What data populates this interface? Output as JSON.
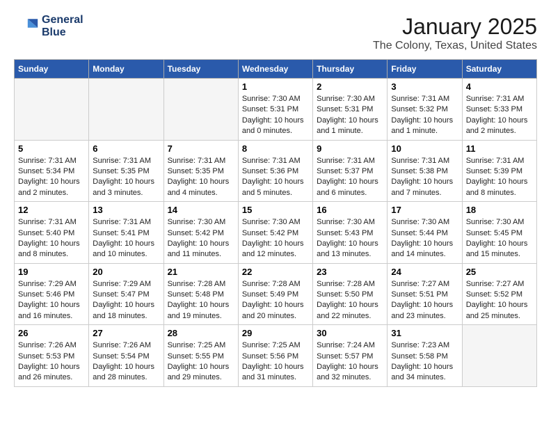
{
  "header": {
    "logo_line1": "General",
    "logo_line2": "Blue",
    "title": "January 2025",
    "subtitle": "The Colony, Texas, United States"
  },
  "weekdays": [
    "Sunday",
    "Monday",
    "Tuesday",
    "Wednesday",
    "Thursday",
    "Friday",
    "Saturday"
  ],
  "weeks": [
    [
      {
        "day": "",
        "empty": true
      },
      {
        "day": "",
        "empty": true
      },
      {
        "day": "",
        "empty": true
      },
      {
        "day": "1",
        "sunrise": "7:30 AM",
        "sunset": "5:31 PM",
        "daylight": "10 hours and 0 minutes."
      },
      {
        "day": "2",
        "sunrise": "7:30 AM",
        "sunset": "5:31 PM",
        "daylight": "10 hours and 1 minute."
      },
      {
        "day": "3",
        "sunrise": "7:31 AM",
        "sunset": "5:32 PM",
        "daylight": "10 hours and 1 minute."
      },
      {
        "day": "4",
        "sunrise": "7:31 AM",
        "sunset": "5:33 PM",
        "daylight": "10 hours and 2 minutes."
      }
    ],
    [
      {
        "day": "5",
        "sunrise": "7:31 AM",
        "sunset": "5:34 PM",
        "daylight": "10 hours and 2 minutes."
      },
      {
        "day": "6",
        "sunrise": "7:31 AM",
        "sunset": "5:35 PM",
        "daylight": "10 hours and 3 minutes."
      },
      {
        "day": "7",
        "sunrise": "7:31 AM",
        "sunset": "5:35 PM",
        "daylight": "10 hours and 4 minutes."
      },
      {
        "day": "8",
        "sunrise": "7:31 AM",
        "sunset": "5:36 PM",
        "daylight": "10 hours and 5 minutes."
      },
      {
        "day": "9",
        "sunrise": "7:31 AM",
        "sunset": "5:37 PM",
        "daylight": "10 hours and 6 minutes."
      },
      {
        "day": "10",
        "sunrise": "7:31 AM",
        "sunset": "5:38 PM",
        "daylight": "10 hours and 7 minutes."
      },
      {
        "day": "11",
        "sunrise": "7:31 AM",
        "sunset": "5:39 PM",
        "daylight": "10 hours and 8 minutes."
      }
    ],
    [
      {
        "day": "12",
        "sunrise": "7:31 AM",
        "sunset": "5:40 PM",
        "daylight": "10 hours and 8 minutes."
      },
      {
        "day": "13",
        "sunrise": "7:31 AM",
        "sunset": "5:41 PM",
        "daylight": "10 hours and 10 minutes."
      },
      {
        "day": "14",
        "sunrise": "7:30 AM",
        "sunset": "5:42 PM",
        "daylight": "10 hours and 11 minutes."
      },
      {
        "day": "15",
        "sunrise": "7:30 AM",
        "sunset": "5:42 PM",
        "daylight": "10 hours and 12 minutes."
      },
      {
        "day": "16",
        "sunrise": "7:30 AM",
        "sunset": "5:43 PM",
        "daylight": "10 hours and 13 minutes."
      },
      {
        "day": "17",
        "sunrise": "7:30 AM",
        "sunset": "5:44 PM",
        "daylight": "10 hours and 14 minutes."
      },
      {
        "day": "18",
        "sunrise": "7:30 AM",
        "sunset": "5:45 PM",
        "daylight": "10 hours and 15 minutes."
      }
    ],
    [
      {
        "day": "19",
        "sunrise": "7:29 AM",
        "sunset": "5:46 PM",
        "daylight": "10 hours and 16 minutes."
      },
      {
        "day": "20",
        "sunrise": "7:29 AM",
        "sunset": "5:47 PM",
        "daylight": "10 hours and 18 minutes."
      },
      {
        "day": "21",
        "sunrise": "7:28 AM",
        "sunset": "5:48 PM",
        "daylight": "10 hours and 19 minutes."
      },
      {
        "day": "22",
        "sunrise": "7:28 AM",
        "sunset": "5:49 PM",
        "daylight": "10 hours and 20 minutes."
      },
      {
        "day": "23",
        "sunrise": "7:28 AM",
        "sunset": "5:50 PM",
        "daylight": "10 hours and 22 minutes."
      },
      {
        "day": "24",
        "sunrise": "7:27 AM",
        "sunset": "5:51 PM",
        "daylight": "10 hours and 23 minutes."
      },
      {
        "day": "25",
        "sunrise": "7:27 AM",
        "sunset": "5:52 PM",
        "daylight": "10 hours and 25 minutes."
      }
    ],
    [
      {
        "day": "26",
        "sunrise": "7:26 AM",
        "sunset": "5:53 PM",
        "daylight": "10 hours and 26 minutes."
      },
      {
        "day": "27",
        "sunrise": "7:26 AM",
        "sunset": "5:54 PM",
        "daylight": "10 hours and 28 minutes."
      },
      {
        "day": "28",
        "sunrise": "7:25 AM",
        "sunset": "5:55 PM",
        "daylight": "10 hours and 29 minutes."
      },
      {
        "day": "29",
        "sunrise": "7:25 AM",
        "sunset": "5:56 PM",
        "daylight": "10 hours and 31 minutes."
      },
      {
        "day": "30",
        "sunrise": "7:24 AM",
        "sunset": "5:57 PM",
        "daylight": "10 hours and 32 minutes."
      },
      {
        "day": "31",
        "sunrise": "7:23 AM",
        "sunset": "5:58 PM",
        "daylight": "10 hours and 34 minutes."
      },
      {
        "day": "",
        "empty": true
      }
    ]
  ],
  "labels": {
    "sunrise_prefix": "Sunrise: ",
    "sunset_prefix": "Sunset: ",
    "daylight_prefix": "Daylight: "
  }
}
